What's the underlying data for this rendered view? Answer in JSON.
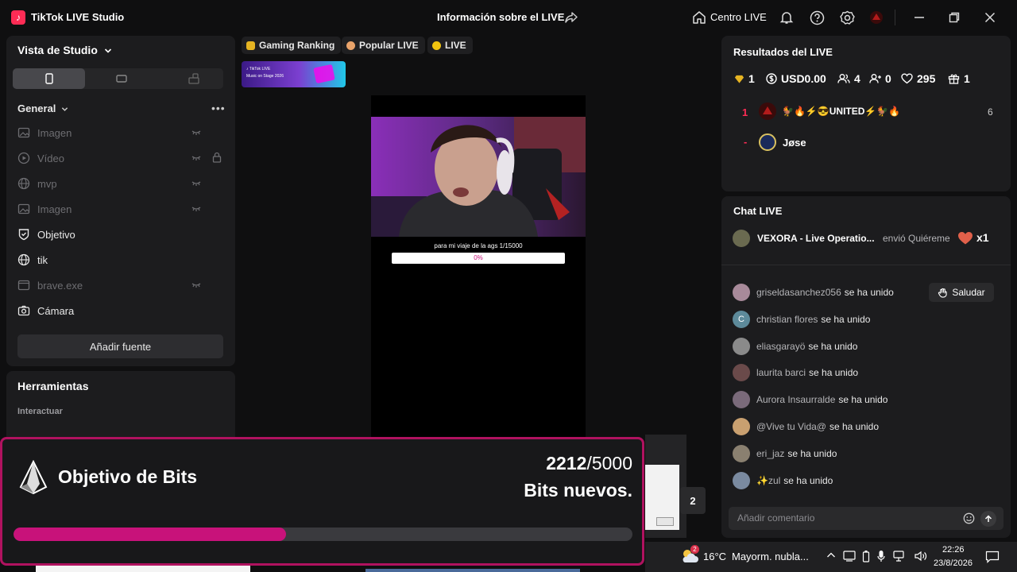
{
  "titlebar": {
    "app_title": "TikTok LIVE Studio",
    "center_title": "Información sobre el LIVE",
    "centro_live": "Centro LIVE"
  },
  "left": {
    "studio_view": "Vista de Studio",
    "general": "General",
    "sources": [
      {
        "label": "Imagen",
        "enabled": false,
        "icon": "image-icon"
      },
      {
        "label": "Vídeo",
        "enabled": false,
        "icon": "video-icon"
      },
      {
        "label": "mvp",
        "enabled": false,
        "icon": "globe-icon"
      },
      {
        "label": "Imagen",
        "enabled": false,
        "icon": "image-icon"
      },
      {
        "label": "Objetivo",
        "enabled": true,
        "icon": "goal-icon"
      },
      {
        "label": "tik",
        "enabled": true,
        "icon": "globe-icon"
      },
      {
        "label": "brave.exe",
        "enabled": false,
        "icon": "window-icon"
      },
      {
        "label": "Cámara",
        "enabled": true,
        "icon": "camera-icon"
      }
    ],
    "add_source": "Añadir fuente",
    "tools_title": "Herramientas",
    "interact": "Interactuar"
  },
  "center": {
    "tags": [
      "Gaming Ranking",
      "Popular LIVE",
      "LIVE"
    ],
    "banner_line1": "♪ TikTok LIVE",
    "banner_line2": "Music on Stage 2026",
    "goal_text": "para mi viaje de la ags  1/15000",
    "goal_percent": "0%",
    "goal_progress": 0,
    "stray_number": "2"
  },
  "results": {
    "title": "Resultados del LIVE",
    "stats": [
      {
        "icon": "diamond-icon",
        "value": "1"
      },
      {
        "icon": "dollar-icon",
        "value": "USD0.00"
      },
      {
        "icon": "users-icon",
        "value": "4"
      },
      {
        "icon": "follow-icon",
        "value": "0"
      },
      {
        "icon": "heart-icon",
        "value": "295"
      },
      {
        "icon": "gift-icon",
        "value": "1"
      }
    ],
    "ranking": [
      {
        "rank": "1",
        "name": "🐓🔥⚡😎UNITED⚡🐓🔥",
        "score": "6"
      },
      {
        "rank": "-",
        "name": "Jøse",
        "score": ""
      }
    ]
  },
  "chat": {
    "title": "Chat LIVE",
    "gift_user": "VEXORA - Live Operatio...",
    "gift_action": "envió Quiéreme",
    "gift_count": "x1",
    "greet_button": "Saludar",
    "joined_suffix": "se ha unido",
    "messages": [
      {
        "user": "griseldasanchez056",
        "avatar_color": "#a88a9a"
      },
      {
        "user": "christian flores",
        "avatar_color": "#5d8a9a",
        "initial": "C"
      },
      {
        "user": "eliasgarayö",
        "avatar_color": "#8a8a8a"
      },
      {
        "user": "laurita barci",
        "avatar_color": "#6a4a4a"
      },
      {
        "user": "Aurora Insaurralde",
        "avatar_color": "#7a6a7a"
      },
      {
        "user": "@Vive tu Vida@",
        "avatar_color": "#c9a070"
      },
      {
        "user": "eri_jaz",
        "avatar_color": "#8a8070"
      },
      {
        "user": "✨zul",
        "avatar_color": "#7a8aa0"
      }
    ],
    "comment_placeholder": "Añadir comentario"
  },
  "overlay": {
    "title": "Objetivo de Bits",
    "current": "2212",
    "target": "/5000",
    "subtitle": "Bits nuevos.",
    "progress": 0.44,
    "accent": "#c8127a"
  },
  "taskbar": {
    "weather_badge": "2",
    "temperature": "16°C",
    "weather_text": "Mayorm. nubla...",
    "time": "22:26",
    "date": "23/8/2026"
  }
}
